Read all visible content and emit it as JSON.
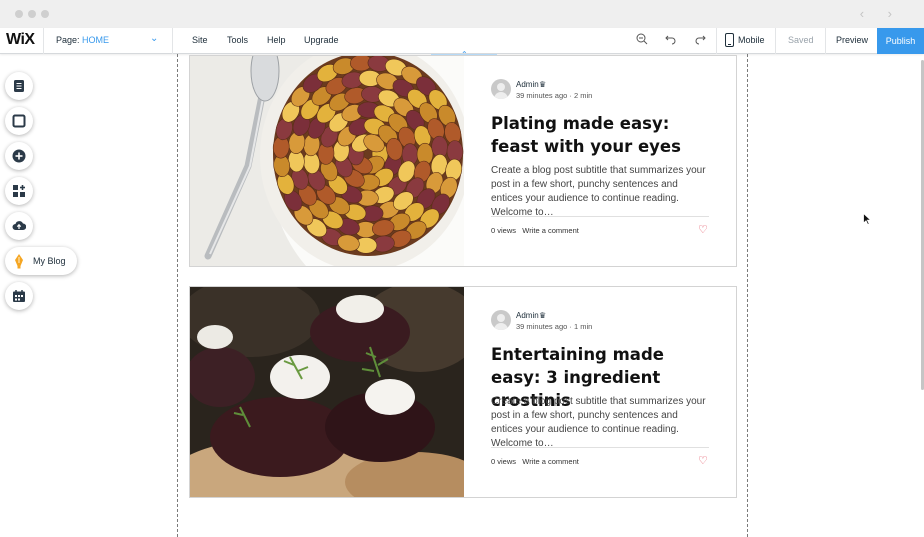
{
  "window": {
    "nav": "‹ ›"
  },
  "topbar": {
    "logo": "WiX",
    "page_label": "Page:",
    "page_value": "HOME",
    "menu": [
      "Site",
      "Tools",
      "Help",
      "Upgrade"
    ],
    "mobile_label": "Mobile",
    "saved_label": "Saved",
    "preview_label": "Preview",
    "publish_label": "Publish"
  },
  "sidebar": {
    "items": [
      {
        "icon": "pages-icon"
      },
      {
        "icon": "background-icon"
      },
      {
        "icon": "add-icon"
      },
      {
        "icon": "app-market-icon"
      },
      {
        "icon": "upload-icon"
      },
      {
        "icon": "blog-pen-icon",
        "label": "My Blog"
      },
      {
        "icon": "bookings-icon"
      }
    ]
  },
  "posts": [
    {
      "author": "Admin",
      "time": "39 minutes ago",
      "read_time": "2 min",
      "title": "Plating made easy: feast with your eyes",
      "excerpt": "Create a blog post subtitle that summarizes your post in a few short, punchy sentences and entices your audience to continue reading. Welcome to…",
      "views": "0 views",
      "comment": "Write a comment",
      "image": "roasted-potatoes-photo"
    },
    {
      "author": "Admin",
      "time": "39 minutes ago",
      "read_time": "1 min",
      "title": "Entertaining made easy: 3 ingredient crostinis",
      "excerpt": "Create a blog post subtitle that summarizes your post in a few short, punchy sentences and entices your audience to continue reading. Welcome to…",
      "views": "0 views",
      "comment": "Write a comment",
      "image": "crostini-photo"
    }
  ],
  "colors": {
    "accent": "#3899ec",
    "heart": "#e0485a"
  }
}
